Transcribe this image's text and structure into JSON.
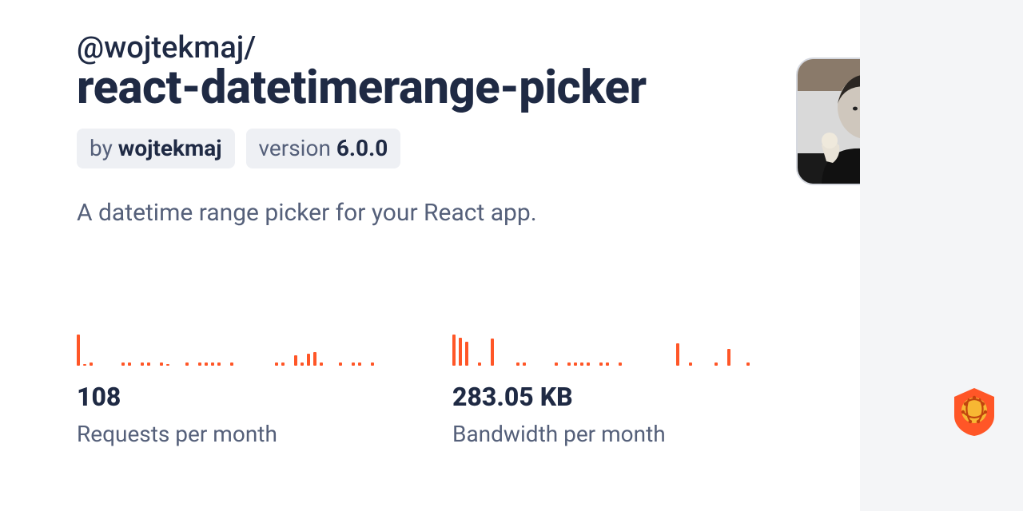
{
  "package": {
    "scope": "@wojtekmaj/",
    "name": "react-datetimerange-picker",
    "author_prefix": "by ",
    "author": "wojtekmaj",
    "version_prefix": "version ",
    "version": "6.0.0",
    "description": "A datetime range picker for your React app."
  },
  "stats": {
    "requests": {
      "value": "108",
      "label": "Requests per month"
    },
    "bandwidth": {
      "value": "283.05 KB",
      "label": "Bandwidth per month"
    }
  },
  "chart_data": [
    {
      "type": "bar",
      "title": "Requests per month",
      "values": [
        42,
        2,
        4,
        0,
        0,
        0,
        0,
        4,
        4,
        0,
        4,
        4,
        0,
        4,
        2,
        0,
        0,
        4,
        0,
        4,
        4,
        4,
        4,
        0,
        4,
        0,
        0,
        0,
        0,
        0,
        0,
        4,
        4,
        0,
        14,
        4,
        16,
        18,
        4,
        0,
        0,
        4,
        0,
        4,
        4,
        0,
        4
      ],
      "ylim": [
        0,
        60
      ]
    },
    {
      "type": "bar",
      "title": "Bandwidth per month",
      "values": [
        42,
        38,
        32,
        0,
        4,
        0,
        36,
        0,
        0,
        0,
        4,
        4,
        0,
        0,
        0,
        0,
        4,
        0,
        4,
        4,
        4,
        4,
        0,
        4,
        4,
        0,
        4,
        0,
        0,
        0,
        0,
        0,
        0,
        0,
        0,
        30,
        0,
        4,
        0,
        0,
        0,
        4,
        0,
        22,
        0,
        0,
        4
      ],
      "ylim": [
        0,
        60
      ]
    }
  ],
  "colors": {
    "accent": "#ff5627",
    "text": "#1f2a44",
    "muted": "#55607a",
    "chip_bg": "#eef0f4",
    "sidebar_bg": "#f4f5f7"
  }
}
